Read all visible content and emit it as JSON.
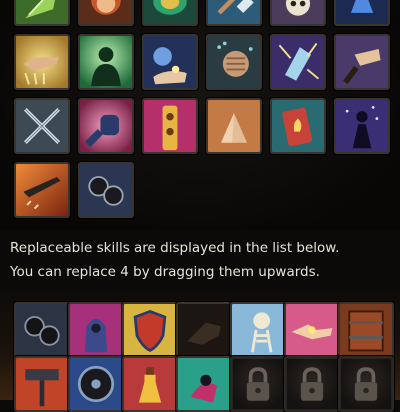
{
  "instructions": {
    "line1": "Replaceable skills are displayed in the list below.",
    "line2": "You can replace 4 by dragging them upwards."
  },
  "equipped_skills": [
    {
      "icon": "green-leaf-skill-icon"
    },
    {
      "icon": "red-haired-hero-icon"
    },
    {
      "icon": "emerald-scarab-icon"
    },
    {
      "icon": "hammer-strike-icon"
    },
    {
      "icon": "skull-icon"
    },
    {
      "icon": "blue-potion-icon"
    },
    {
      "icon": "golden-hand-icon"
    },
    {
      "icon": "green-silhouette-icon"
    },
    {
      "icon": "blue-orb-hand-icon"
    },
    {
      "icon": "clenched-fist-icon"
    },
    {
      "icon": "crystal-strike-icon"
    },
    {
      "icon": "reaching-hand-icon"
    },
    {
      "icon": "crossed-swords-icon"
    },
    {
      "icon": "power-punch-icon"
    },
    {
      "icon": "golden-totem-icon"
    },
    {
      "icon": "praying-hands-icon"
    },
    {
      "icon": "fire-card-icon"
    },
    {
      "icon": "shadow-mage-icon"
    },
    {
      "icon": "dagger-slash-icon"
    },
    {
      "icon": "dark-coins-icon"
    }
  ],
  "replaceable_skills": [
    {
      "icon": "dark-coins-icon"
    },
    {
      "icon": "hooded-figure-icon"
    },
    {
      "icon": "shield-icon"
    },
    {
      "icon": "shadow-hand-icon"
    },
    {
      "icon": "skeleton-icon"
    },
    {
      "icon": "handshake-icon"
    },
    {
      "icon": "iron-door-icon"
    },
    {
      "icon": "twin-hammer-icon"
    },
    {
      "icon": "wheel-icon"
    },
    {
      "icon": "potion-bottle-icon"
    },
    {
      "icon": "dark-sprite-icon"
    },
    {
      "icon": "padlock-icon",
      "locked": true
    },
    {
      "icon": "padlock-icon",
      "locked": true
    },
    {
      "icon": "padlock-icon",
      "locked": true
    }
  ]
}
